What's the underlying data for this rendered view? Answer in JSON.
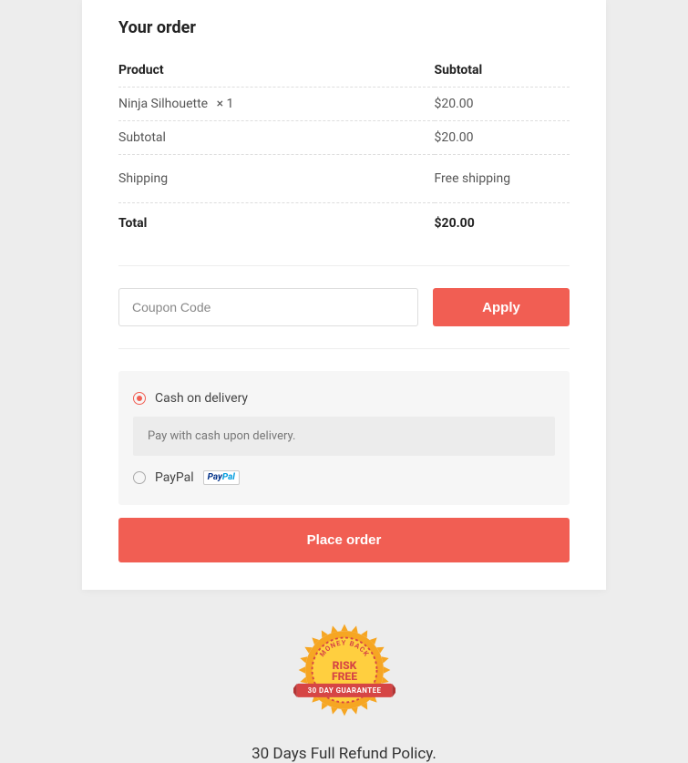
{
  "section_title": "Your order",
  "headers": {
    "product": "Product",
    "subtotal": "Subtotal"
  },
  "line_item": {
    "name": "Ninja Silhouette",
    "qty": "× 1",
    "price": "$20.00"
  },
  "subtotal_row": {
    "label": "Subtotal",
    "value": "$20.00"
  },
  "shipping_row": {
    "label": "Shipping",
    "value": "Free shipping"
  },
  "total_row": {
    "label": "Total",
    "value": "$20.00"
  },
  "coupon": {
    "placeholder": "Coupon Code",
    "apply_label": "Apply"
  },
  "payment": {
    "cod_label": "Cash on delivery",
    "cod_desc": "Pay with cash upon delivery.",
    "paypal_label": "PayPal"
  },
  "place_order_label": "Place order",
  "refund_policy": "30 Days Full Refund Policy."
}
